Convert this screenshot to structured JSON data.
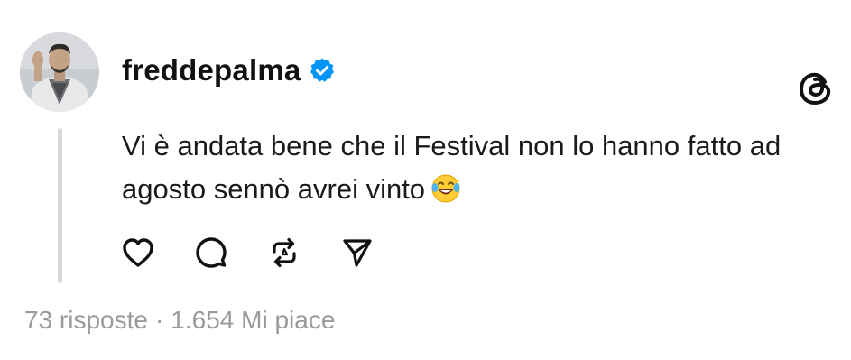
{
  "post": {
    "username": "freddepalma",
    "verified": true,
    "text": "Vi è andata bene che il Festival non lo hanno fatto ad agosto sennò avrei vinto",
    "emoji": "face-with-tears-of-joy",
    "replies_label": "73 risposte",
    "separator": "·",
    "likes_label": "1.654 Mi piace"
  },
  "actions": [
    {
      "name": "like",
      "icon": "heart-icon"
    },
    {
      "name": "reply",
      "icon": "comment-icon"
    },
    {
      "name": "repost",
      "icon": "repost-icon"
    },
    {
      "name": "share",
      "icon": "send-icon"
    }
  ],
  "colors": {
    "verified_badge": "#0095f6",
    "text": "#1a1a1a",
    "muted": "#9a9a9a",
    "thread_line": "#d9d9d9"
  },
  "app_logo": "threads-logo"
}
